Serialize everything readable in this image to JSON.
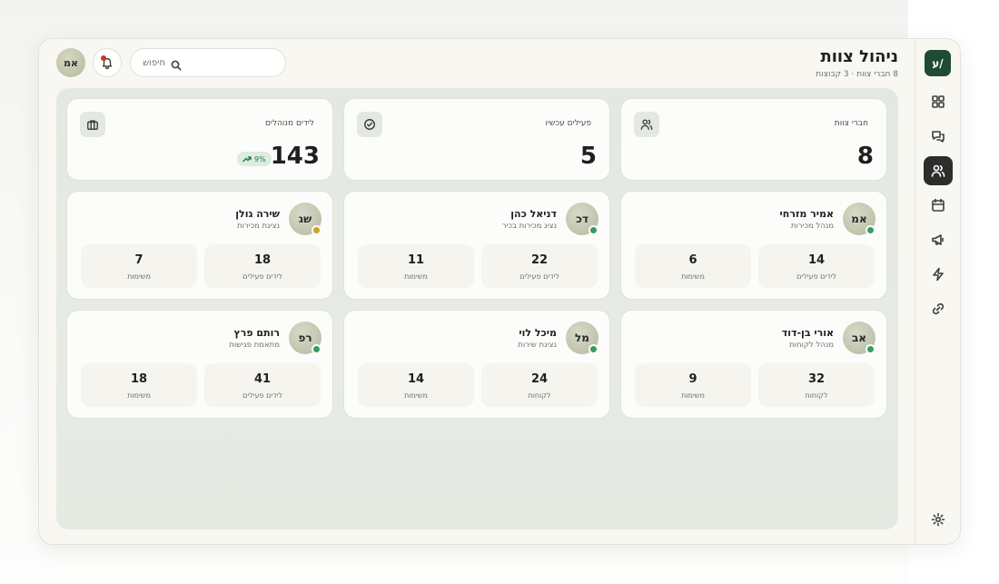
{
  "header": {
    "title": "ניהול צוות",
    "subtitle": "8 חברי צוות · 3 קבוצות",
    "search_placeholder": "חיפוש",
    "user_initials": "אמ"
  },
  "sidebar": {
    "logo_text": "ע/",
    "items": [
      {
        "name": "dashboard",
        "icon": "grid-icon",
        "active": false
      },
      {
        "name": "messages",
        "icon": "chat-icon",
        "active": false
      },
      {
        "name": "team",
        "icon": "users-icon",
        "active": true
      },
      {
        "name": "calendar",
        "icon": "calendar-icon",
        "active": false
      },
      {
        "name": "campaigns",
        "icon": "megaphone-icon",
        "active": false
      },
      {
        "name": "automations",
        "icon": "lightning-icon",
        "active": false
      },
      {
        "name": "integrations",
        "icon": "link-icon",
        "active": false
      }
    ],
    "settings_icon": "gear-icon"
  },
  "stats": [
    {
      "label": "חברי צוות",
      "value": "8",
      "icon": "users-icon"
    },
    {
      "label": "פעילים עכשיו",
      "value": "5",
      "icon": "check-circle-icon"
    },
    {
      "label": "לידים מנוהלים",
      "value": "143",
      "icon": "briefcase-icon",
      "badge": "9%"
    }
  ],
  "members": [
    {
      "initials": "אמ",
      "name": "אמיר מזרחי",
      "role": "מנהל מכירות",
      "status_color": "#3a9a62",
      "stats": [
        {
          "value": "14",
          "label": "לידים פעילים"
        },
        {
          "value": "6",
          "label": "משימות"
        }
      ]
    },
    {
      "initials": "דכ",
      "name": "דניאל כהן",
      "role": "נציג מכירות בכיר",
      "status_color": "#3a9a62",
      "stats": [
        {
          "value": "22",
          "label": "לידים פעילים"
        },
        {
          "value": "11",
          "label": "משימות"
        }
      ]
    },
    {
      "initials": "שג",
      "name": "שירה גולן",
      "role": "נציגת מכירות",
      "status_color": "#c9a227",
      "stats": [
        {
          "value": "18",
          "label": "לידים פעילים"
        },
        {
          "value": "7",
          "label": "משימות"
        }
      ]
    },
    {
      "initials": "אב",
      "name": "אורי בן-דוד",
      "role": "מנהל לקוחות",
      "status_color": "#3a9a62",
      "stats": [
        {
          "value": "32",
          "label": "לקוחות"
        },
        {
          "value": "9",
          "label": "משימות"
        }
      ]
    },
    {
      "initials": "מל",
      "name": "מיכל לוי",
      "role": "נציגת שירות",
      "status_color": "#3a9a62",
      "stats": [
        {
          "value": "24",
          "label": "לקוחות"
        },
        {
          "value": "14",
          "label": "משימות"
        }
      ]
    },
    {
      "initials": "רפ",
      "name": "רותם פרץ",
      "role": "מתאמת פגישות",
      "status_color": "#3a9a62",
      "stats": [
        {
          "value": "41",
          "label": "לידים פעילים"
        },
        {
          "value": "18",
          "label": "משימות"
        }
      ]
    }
  ]
}
